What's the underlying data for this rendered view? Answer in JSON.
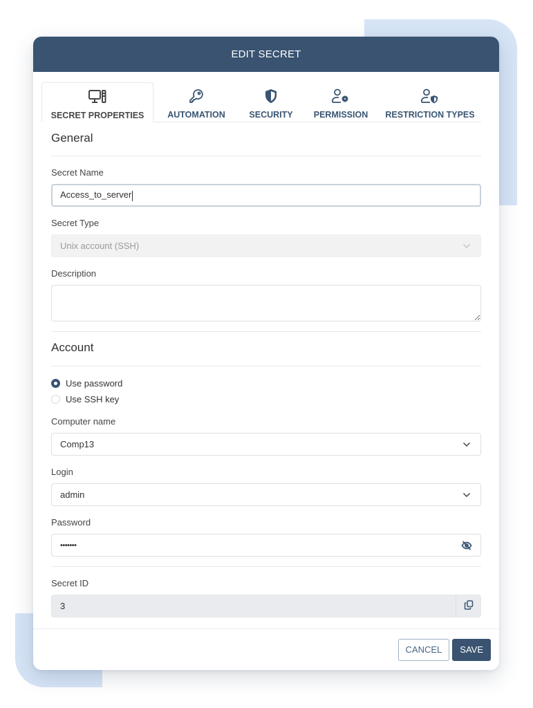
{
  "dialog": {
    "title": "EDIT SECRET"
  },
  "tabs": [
    {
      "label": "SECRET PROPERTIES",
      "icon": "computer-icon",
      "active": true
    },
    {
      "label": "AUTOMATION",
      "icon": "key-icon",
      "active": false
    },
    {
      "label": "SECURITY",
      "icon": "shield-icon",
      "active": false
    },
    {
      "label": "PERMISSION",
      "icon": "user-gear-icon",
      "active": false
    },
    {
      "label": "RESTRICTION TYPES",
      "icon": "user-shield-icon",
      "active": false
    }
  ],
  "general": {
    "title": "General",
    "secret_name": {
      "label": "Secret Name",
      "value": "Access_to_server"
    },
    "secret_type": {
      "label": "Secret Type",
      "value": "Unix account (SSH)",
      "disabled": true
    },
    "description": {
      "label": "Description",
      "value": ""
    }
  },
  "account": {
    "title": "Account",
    "auth_options": [
      {
        "label": "Use password",
        "checked": true
      },
      {
        "label": "Use SSH key",
        "checked": false
      }
    ],
    "computer_name": {
      "label": "Computer name",
      "value": "Comp13"
    },
    "login": {
      "label": "Login",
      "value": "admin"
    },
    "password": {
      "label": "Password",
      "value": "•••••••"
    }
  },
  "secret_id": {
    "label": "Secret ID",
    "value": "3"
  },
  "footer": {
    "cancel_label": "CANCEL",
    "save_label": "SAVE"
  },
  "colors": {
    "header": "#395371",
    "accent": "#395371",
    "tab_text": "#3a5573",
    "decoration": "#d6e4f6"
  }
}
